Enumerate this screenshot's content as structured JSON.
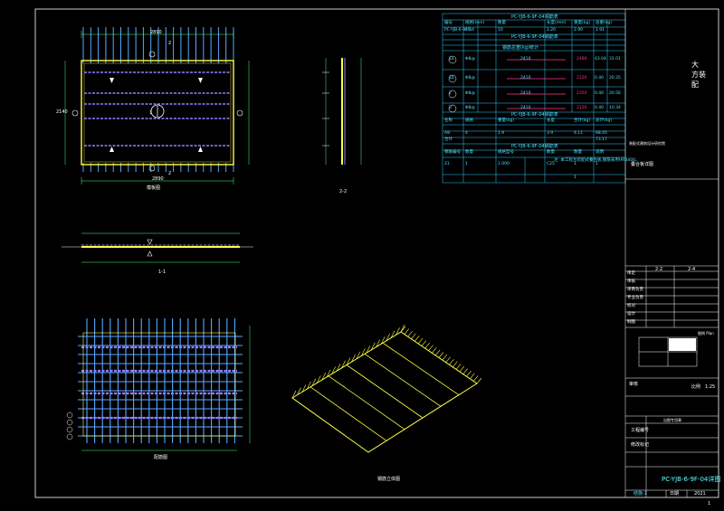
{
  "labels": {
    "plan_caption": "模板图",
    "section_caption": "1-1",
    "section2_caption": "2-2",
    "rebar_caption": "配筋图",
    "iso_caption": "钢筋立体图",
    "dim_top": "2890",
    "dim_bottom": "2890",
    "dim_left": "2140",
    "cut_mark": "2",
    "cut_mark1": "1"
  },
  "schedule": {
    "title1": "PC-YJB-6-9F-04钢筋表",
    "title2": "PC-YJB-6-9F-04钢筋表",
    "title3": "PC-YJB-6-9F-04钢筋表",
    "title4": "PC-YJB-6-9F-04钢筋表",
    "header1": [
      "编号",
      "规格(mm)",
      "数量",
      "长度(mm)",
      "重量(kg)",
      "总重(kg)"
    ],
    "row0": [
      "PC-YJB-6-9F-04",
      "45",
      "10",
      "2.20",
      "2.90",
      "1.91"
    ],
    "rows": [
      {
        "id": "1a",
        "spec": "Φ8@",
        "len": "2410",
        "qty": "2480",
        "w": "43.04",
        "tw": "31.01"
      },
      {
        "id": "1b",
        "spec": "Φ8@",
        "len": "2410",
        "qty": "2120",
        "w": "0.40",
        "tw": "20.35"
      },
      {
        "id": "2",
        "spec": "Φ8@",
        "len": "2410",
        "qty": "2350",
        "w": "0.40",
        "tw": "20.56"
      },
      {
        "id": "3",
        "spec": "Φ8@",
        "len": "2410",
        "qty": "2120",
        "w": "0.40",
        "tw": "10.34"
      }
    ],
    "sub_header": "钢筋总重(kg)统计",
    "header2": [
      "名称",
      "规格",
      "重量(kg)",
      "长度",
      "合计(kg)",
      "总计(kg)"
    ],
    "row_a": [
      "A8",
      "4",
      "1.9",
      "3.9",
      "4.11",
      "68.45"
    ],
    "row_b": [
      "合计",
      "",
      "",
      "",
      "",
      "73.17"
    ],
    "header3": [
      "钢筋编号",
      "数量",
      "规格型号",
      "数量",
      "数量",
      "说明"
    ],
    "row_c": [
      "21",
      "1",
      "1.000",
      "C25",
      "1",
      "1"
    ],
    "note": "注: 本工程为装配式叠合板,钢筋采用HRB400。",
    "row_d": [
      "",
      "",
      "",
      "",
      "1",
      ""
    ]
  },
  "title_block": {
    "company": "大\n方装\n配",
    "project_label": "装配式建筑设计研究院",
    "drawing_title": "叠合板详图",
    "scale_lbl": "比例",
    "scale_val": "1:25",
    "rows": [
      "审定",
      "审核",
      "项目负责",
      "专业负责",
      "校对",
      "设计",
      "制图"
    ],
    "grid_a": "2-2",
    "grid_b": "2-4",
    "key_label": "图例 Plan",
    "drawing_no": "PC-YJB-6-9F-04详图",
    "footer_left": "结施-1",
    "footer_mid": "日期",
    "footer_right": "2021",
    "sign1": "审核",
    "sign2": "工程编号",
    "sign3": "修改标记",
    "stamp_label": "出图专用章",
    "page": "1"
  },
  "colors": {
    "background": "#000000",
    "frame": "#ffffff",
    "slab": "#ffff44",
    "rebar": "#55aaff",
    "stirrup": "#8866ff",
    "dim": "#44ff88",
    "table": "#33ccff",
    "accent": "#ff3399"
  }
}
